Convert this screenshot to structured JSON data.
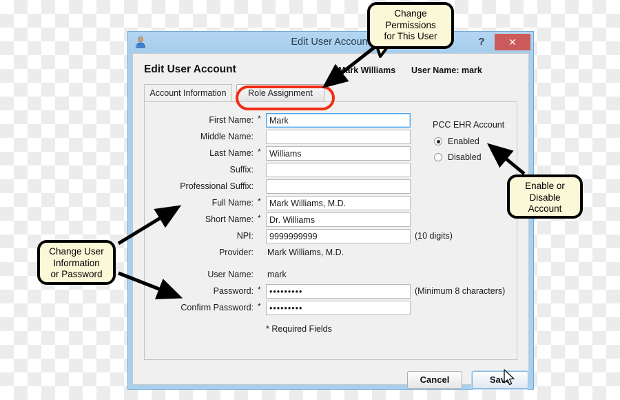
{
  "window": {
    "title": "Edit User Account",
    "icon": "user-icon",
    "help_label": "?",
    "close_label": "✕",
    "titlebar_color": "#a6cdec",
    "close_color": "#cc5a5a"
  },
  "header": {
    "heading": "Edit User Account",
    "display_name": "Mark Williams",
    "user_name_line": "User Name: mark"
  },
  "tabs": [
    {
      "label": "Account Information",
      "active": true
    },
    {
      "label": "Role Assignment",
      "active": false
    }
  ],
  "form": {
    "fields": [
      {
        "label": "First Name:",
        "required": true,
        "value": "Mark",
        "type": "input",
        "focused": true
      },
      {
        "label": "Middle Name:",
        "required": false,
        "value": "",
        "type": "input",
        "focused": false
      },
      {
        "label": "Last Name:",
        "required": true,
        "value": "Williams",
        "type": "input",
        "focused": false
      },
      {
        "label": "Suffix:",
        "required": false,
        "value": "",
        "type": "input",
        "focused": false
      },
      {
        "label": "Professional Suffix:",
        "required": false,
        "value": "",
        "type": "input",
        "focused": false
      },
      {
        "label": "Full Name:",
        "required": true,
        "value": "Mark Williams, M.D.",
        "type": "input",
        "focused": false
      },
      {
        "label": "Short Name:",
        "required": true,
        "value": "Dr. Williams",
        "type": "input",
        "focused": false
      },
      {
        "label": "NPI:",
        "required": false,
        "value": "9999999999",
        "type": "input",
        "focused": false,
        "hint": "(10 digits)"
      },
      {
        "label": "Provider:",
        "required": false,
        "value": "Mark Williams, M.D.",
        "type": "static",
        "focused": false
      },
      {
        "label": "User Name:",
        "required": false,
        "value": "mark",
        "type": "static",
        "focused": false
      },
      {
        "label": "Password:",
        "required": true,
        "value": "•••••••••",
        "type": "input",
        "focused": false,
        "hint": "(Minimum 8 characters)"
      },
      {
        "label": "Confirm Password:",
        "required": true,
        "value": "•••••••••",
        "type": "input",
        "focused": false
      }
    ],
    "required_note": "* Required Fields",
    "required_marker": "*"
  },
  "right_pane": {
    "title": "PCC EHR Account",
    "options": [
      {
        "label": "Enabled",
        "selected": true
      },
      {
        "label": "Disabled",
        "selected": false
      }
    ]
  },
  "footer": {
    "cancel_label": "Cancel",
    "save_label": "Save"
  },
  "annotations": {
    "callouts": [
      {
        "id": "permissions",
        "text": "Change\nPermissions\nfor This User"
      },
      {
        "id": "user-info",
        "text": "Change User\nInformation\nor Password"
      },
      {
        "id": "enable-disable",
        "text": "Enable or\nDisable\nAccount"
      }
    ],
    "highlight_color": "#f22c12",
    "callout_fill": "#fbf8d8"
  }
}
